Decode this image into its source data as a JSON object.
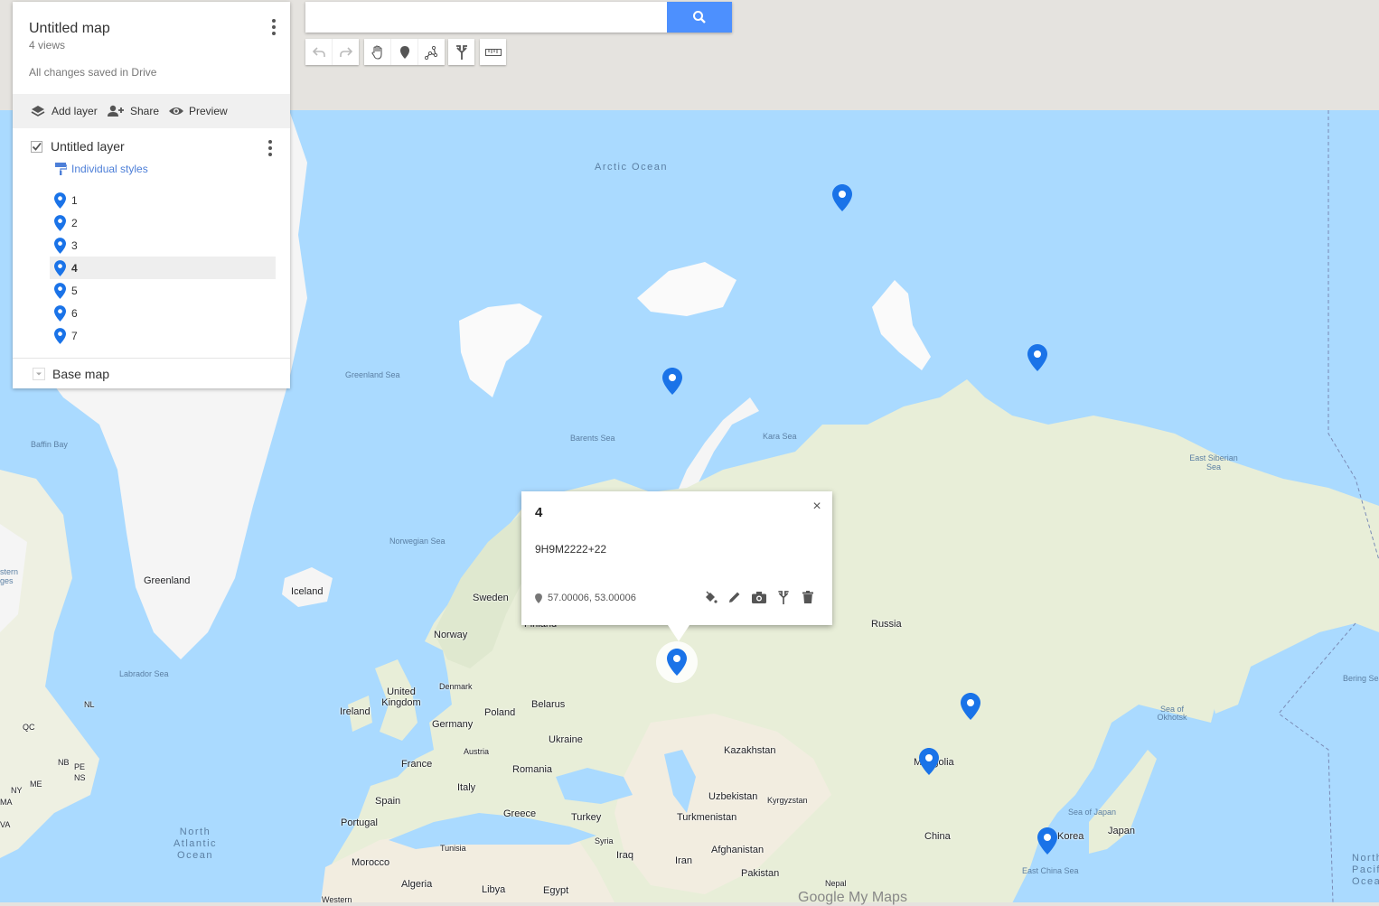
{
  "panel": {
    "title": "Untitled map",
    "views": "4 views",
    "save_status": "All changes saved in Drive",
    "actions": {
      "add_layer": "Add layer",
      "share": "Share",
      "preview": "Preview"
    },
    "layer": {
      "name": "Untitled layer",
      "checked": true,
      "style": "Individual styles",
      "items": [
        "1",
        "2",
        "3",
        "4",
        "5",
        "6",
        "7"
      ],
      "selected_item": "4"
    },
    "base_map": "Base map"
  },
  "search": {
    "value": "",
    "placeholder": ""
  },
  "toolbar": [
    "undo-icon",
    "redo-icon",
    "hand-icon",
    "marker-icon",
    "line-icon",
    "directions-icon",
    "ruler-icon"
  ],
  "info_window": {
    "title": "4",
    "description": "9H9M2222+22",
    "coordinates": "57.00006, 53.00006",
    "tools": [
      "paint-bucket-icon",
      "pencil-icon",
      "camera-icon",
      "directions-icon",
      "trash-icon"
    ]
  },
  "map": {
    "labels": {
      "arctic_ocean": "Arctic Ocean",
      "greenland_sea": "Greenland Sea",
      "baffin_bay": "Baffin Bay",
      "barents_sea": "Barents Sea",
      "kara_sea": "Kara Sea",
      "east_siberian_sea": "East Siberian Sea",
      "norwegian_sea": "Norwegian Sea",
      "greenland": "Greenland",
      "iceland": "Iceland",
      "sweden": "Sweden",
      "finland": "Finland",
      "norway": "Norway",
      "russia": "Russia",
      "labrador_sea": "Labrador Sea",
      "denmark": "Denmark",
      "united_kingdom": "United Kingdom",
      "belarus": "Belarus",
      "ireland": "Ireland",
      "poland": "Poland",
      "germany": "Germany",
      "ukraine": "Ukraine",
      "kazakhstan": "Kazakhstan",
      "austria": "Austria",
      "france": "France",
      "romania": "Romania",
      "mongolia": "Mongolia",
      "bering_sea": "Bering Sea",
      "sea_of_okhotsk": "Sea of Okhotsk",
      "italy": "Italy",
      "uzbekistan": "Uzbekistan",
      "kyrgyzstan": "Kyrgyzstan",
      "spain": "Spain",
      "turkmenistan": "Turkmenistan",
      "greece": "Greece",
      "turkey": "Turkey",
      "portugal": "Portugal",
      "sea_of_japan": "Sea of Japan",
      "japan": "Japan",
      "north_atlantic_ocean": "North Atlantic Ocean",
      "syria": "Syria",
      "afghanistan": "Afghanistan",
      "tunisia": "Tunisia",
      "china": "China",
      "korea": "Korea",
      "iraq": "Iraq",
      "morocco": "Morocco",
      "iran": "Iran",
      "pakistan": "Pakistan",
      "algeria": "Algeria",
      "libya": "Libya",
      "egypt": "Egypt",
      "nepal": "Nepal",
      "east_china_sea": "East China Sea",
      "western": "Western",
      "nl": "NL",
      "qc": "QC",
      "nb": "NB",
      "pe": "PE",
      "ns": "NS",
      "me": "ME",
      "ny": "NY",
      "va": "VA",
      "ma": "MA",
      "stern": "stern",
      "ges": "ges",
      "north_pacific_ocean": "North Pacific Ocean"
    },
    "logo": "Google My Maps",
    "colors": {
      "water": "#aadaff",
      "land": "#eef0e2",
      "pin": "#1a73e8"
    }
  }
}
